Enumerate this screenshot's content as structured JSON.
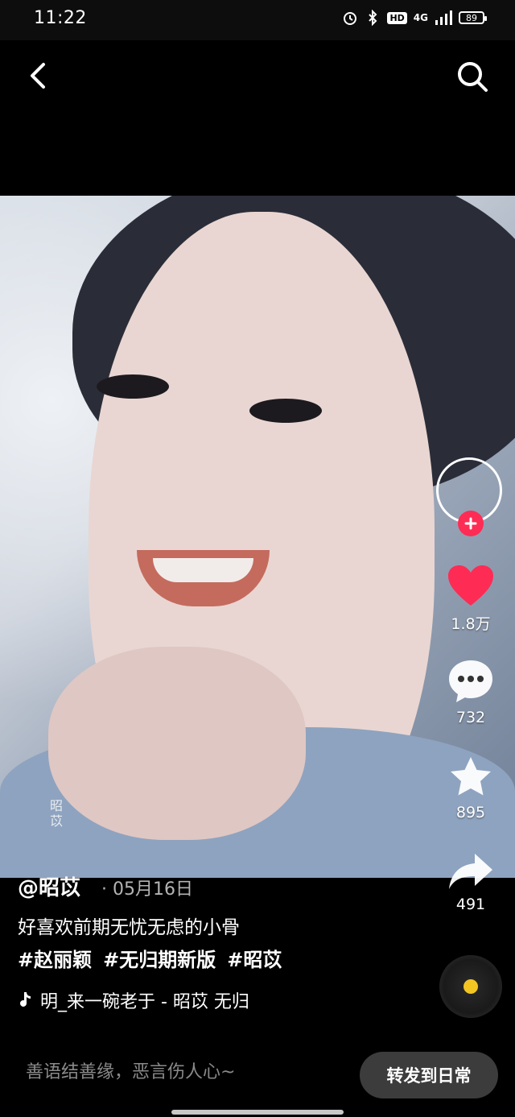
{
  "status_bar": {
    "time": "11:22",
    "hd_label": "HD",
    "network_label": "4G",
    "battery_level": "89"
  },
  "header": {
    "back_icon": "chevron-left-icon",
    "search_icon": "search-icon"
  },
  "video": {
    "watermark": "昭苡"
  },
  "actions": {
    "follow_icon": "plus-icon",
    "like_count": "1.8万",
    "comment_count": "732",
    "favorite_count": "895",
    "share_count": "491",
    "like_color": "#fe2c55"
  },
  "post": {
    "author": "@昭苡",
    "date": "· 05月16日",
    "caption": "好喜欢前期无忧无虑的小骨",
    "tags": [
      "#赵丽颖",
      "#无归期新版",
      "#昭苡"
    ],
    "music": "明_来一碗老于 - 昭苡   无归"
  },
  "bottom_bar": {
    "comment_placeholder": "善语结善缘，恶言伤人心~",
    "forward_label": "转发到日常"
  }
}
